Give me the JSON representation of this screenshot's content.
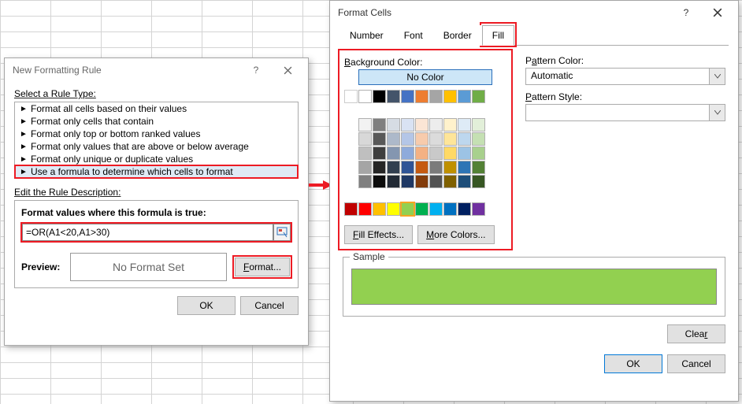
{
  "nf": {
    "title": "New Formatting Rule",
    "select_label": "Select a Rule Type:",
    "rules": [
      "Format all cells based on their values",
      "Format only cells that contain",
      "Format only top or bottom ranked values",
      "Format only values that are above or below average",
      "Format only unique or duplicate values",
      "Use a formula to determine which cells to format"
    ],
    "edit_label": "Edit the Rule Description:",
    "formula_label": "Format values where this formula is true:",
    "formula": "=OR(A1<20,A1>30)",
    "preview_label": "Preview:",
    "preview_value": "No Format Set",
    "format_btn": "Format...",
    "ok": "OK",
    "cancel": "Cancel"
  },
  "fc": {
    "title": "Format Cells",
    "tabs": [
      "Number",
      "Font",
      "Border",
      "Fill"
    ],
    "active_tab": "Fill",
    "bg_label": "Background Color:",
    "no_color": "No Color",
    "fill_effects": "Fill Effects...",
    "more_colors": "More Colors...",
    "pattern_color_label": "Pattern Color:",
    "pattern_color_value": "Automatic",
    "pattern_style_label": "Pattern Style:",
    "pattern_style_value": "",
    "sample_label": "Sample",
    "sample_color": "#92d050",
    "clear": "Clear",
    "ok": "OK",
    "cancel": "Cancel",
    "theme_colors": [
      [
        "#ffffff",
        "#000000",
        "#44546a",
        "#4472c4",
        "#ed7d31",
        "#a5a5a5",
        "#ffc000",
        "#5b9bd5",
        "#70ad47"
      ],
      [
        "#f2f2f2",
        "#7f7f7f",
        "#d6dce4",
        "#d9e2f3",
        "#fbe5d5",
        "#ededed",
        "#fff2cc",
        "#deebf6",
        "#e2efd9"
      ],
      [
        "#d8d8d8",
        "#595959",
        "#adb9ca",
        "#b4c6e7",
        "#f7cbac",
        "#dbdbdb",
        "#fee599",
        "#bdd7ee",
        "#c5e0b3"
      ],
      [
        "#bfbfbf",
        "#3f3f3f",
        "#8496b0",
        "#8eaadb",
        "#f4b183",
        "#c9c9c9",
        "#ffd965",
        "#9cc3e5",
        "#a8d08d"
      ],
      [
        "#a5a5a5",
        "#262626",
        "#323f4f",
        "#2f5496",
        "#c55a11",
        "#7b7b7b",
        "#bf9000",
        "#2e75b5",
        "#538135"
      ],
      [
        "#7f7f7f",
        "#0c0c0c",
        "#222a35",
        "#1f3864",
        "#833c0b",
        "#525252",
        "#7f6000",
        "#1e4e79",
        "#375623"
      ]
    ],
    "standard_colors": [
      "#c00000",
      "#ff0000",
      "#ffc000",
      "#ffff00",
      "#92d050",
      "#00b050",
      "#00b0f0",
      "#0070c0",
      "#002060",
      "#7030a0"
    ]
  }
}
